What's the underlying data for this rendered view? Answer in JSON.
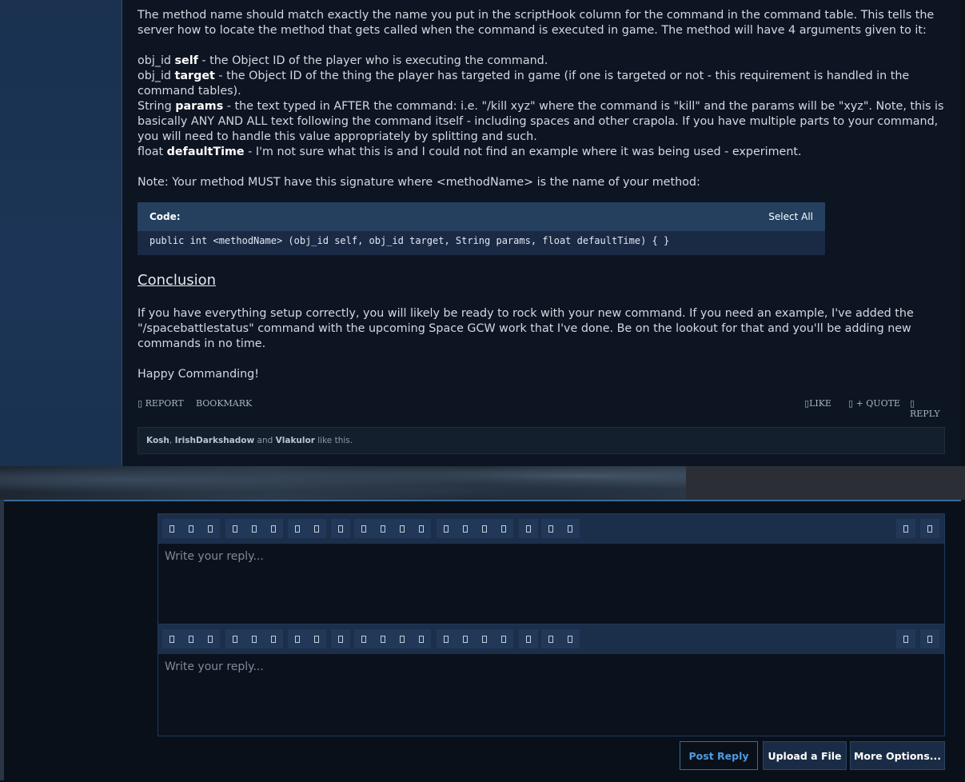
{
  "post": {
    "intro": "The method name should match exactly the name you put in the scriptHook column for the command in the command table. This tells the server how to locate the method that gets called when the command is executed in game. The method will have 4 arguments given to it:",
    "args": [
      {
        "type": "obj_id",
        "name": "self",
        "desc": " - the Object ID of the player who is executing the command."
      },
      {
        "type": "obj_id",
        "name": "target",
        "desc": " - the Object ID of the thing the player has targeted in game (if one is targeted or not - this requirement is handled in the command tables)."
      },
      {
        "type": "String",
        "name": "params",
        "desc": " - the text typed in AFTER the command: i.e. \"/kill xyz\" where the command is \"kill\" and the params will be \"xyz\". Note, this is basically ANY AND ALL text following the command itself - including spaces and other crapola. If you have multiple parts to your command, you will need to handle this value appropriately by splitting and such."
      },
      {
        "type": "float",
        "name": "defaultTime",
        "desc": " - I'm not sure what this is and I could not find an example where it was being used - experiment."
      }
    ],
    "note": "Note: Your method MUST have this signature where <methodName> is the name of your method:",
    "code": {
      "label": "Code:",
      "select_all": "Select All",
      "line": "public int <methodName> (obj_id self, obj_id target, String params, float defaultTime) { }"
    },
    "heading": "Conclusion",
    "conclusion": "If you have everything setup correctly, you will likely be ready to rock with your new command. If you need an example, I've added the \"/spacebattlestatus\" command with the upcoming Space GCW work that I've done. Be on the lookout for that and you'll be adding new commands in no time.",
    "signoff": "Happy Commanding!",
    "actions": {
      "report": "REPORT",
      "bookmark": "BOOKMARK",
      "like": "LIKE",
      "quote": "+ QUOTE",
      "reply": "REPLY"
    },
    "likes": {
      "user1": "Kosh",
      "sep": ", ",
      "user2": "IrishDarkshadow",
      "and": " and ",
      "user3": "Vlakulor",
      "suffix": " like this."
    }
  },
  "reply": {
    "placeholder1": "Write your reply...",
    "placeholder2": "Write your reply...",
    "post_reply": "Post Reply",
    "upload": "Upload a File",
    "more": "More Options..."
  }
}
